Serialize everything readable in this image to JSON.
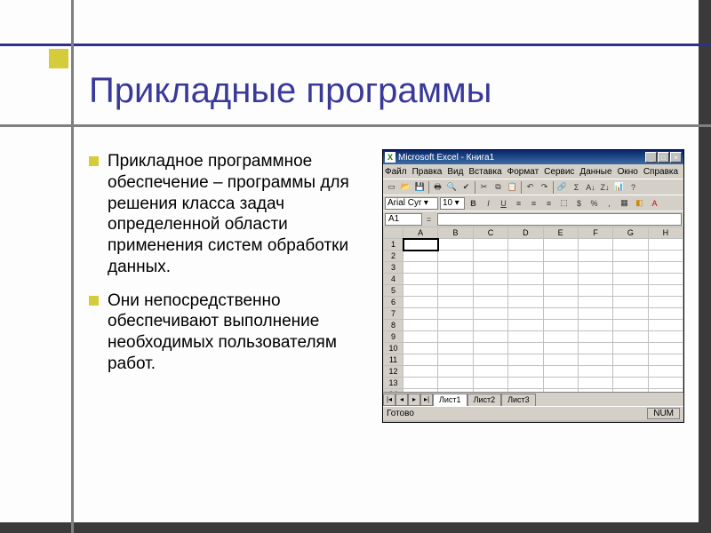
{
  "title": "Прикладные программы",
  "bullets": [
    "Прикладное программное обеспечение – программы для решения класса задач определенной области применения систем обработки данных.",
    "Они непосредственно обеспечивают выполнение необходимых пользователям работ."
  ],
  "excel": {
    "app_icon_letter": "X",
    "title": "Microsoft Excel - Книга1",
    "win_buttons": {
      "min": "_",
      "max": "□",
      "close": "×"
    },
    "menus": [
      "Файл",
      "Правка",
      "Вид",
      "Вставка",
      "Формат",
      "Сервис",
      "Данные",
      "Окно",
      "Справка"
    ],
    "toolbar_icons": [
      "new",
      "open",
      "save",
      "print",
      "preview",
      "spell",
      "cut",
      "copy",
      "paste",
      "undo",
      "redo",
      "link",
      "sum",
      "sort-asc",
      "sort-desc",
      "chart",
      "zoom",
      "help"
    ],
    "format": {
      "font_name": "Arial Cyr",
      "font_size": "10",
      "buttons": [
        "B",
        "I",
        "U",
        "align-left",
        "align-center",
        "align-right",
        "merge",
        "currency",
        "percent",
        "comma",
        "dec-inc",
        "dec-dec",
        "indent-dec",
        "indent-inc",
        "border",
        "fill",
        "font-color"
      ]
    },
    "namebox": "A1",
    "columns": [
      "",
      "A",
      "B",
      "C",
      "D",
      "E",
      "F",
      "G",
      "H"
    ],
    "row_count": 22,
    "selected_cell": {
      "row": 1,
      "col": "A"
    },
    "sheet_nav": [
      "|◂",
      "◂",
      "▸",
      "▸|"
    ],
    "sheets": [
      "Лист1",
      "Лист2",
      "Лист3"
    ],
    "active_sheet": 0,
    "status_ready": "Готово",
    "status_num": "NUM"
  }
}
